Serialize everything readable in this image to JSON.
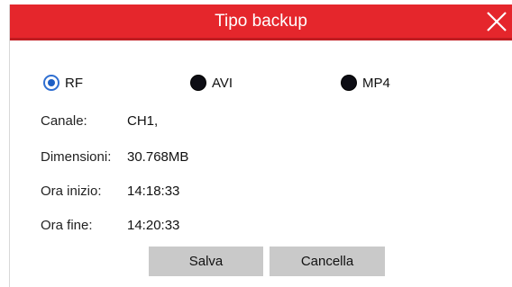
{
  "dialog": {
    "title": "Tipo backup",
    "accent_color": "#e5262c",
    "close_icon": "close-icon"
  },
  "format_options": [
    {
      "label": "RF",
      "checked": true
    },
    {
      "label": "AVI",
      "checked": false
    },
    {
      "label": "MP4",
      "checked": false
    }
  ],
  "info": {
    "channel_label": "Canale:",
    "channel_value": "CH1,",
    "size_label": "Dimensioni:",
    "size_value": "30.768MB",
    "start_label": "Ora inizio:",
    "start_value": "14:18:33",
    "end_label": "Ora fine:",
    "end_value": "14:20:33"
  },
  "buttons": {
    "save_label": "Salva",
    "cancel_label": "Cancella"
  }
}
